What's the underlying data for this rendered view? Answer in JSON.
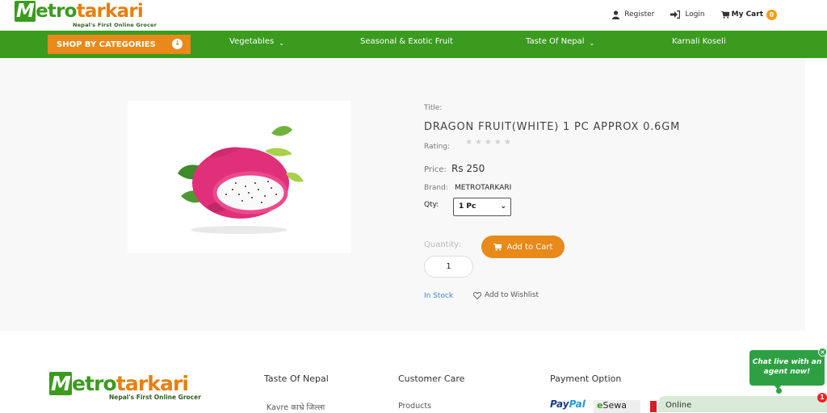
{
  "header": {
    "logo": {
      "m": "M",
      "rest_green": "etro",
      "rest_orange": "tarkari",
      "tagline": "Nepal's First Online Grocer"
    },
    "register_label": "Register",
    "login_label": "Login",
    "cart_label": "My Cart",
    "cart_count": "0"
  },
  "nav": {
    "shop_by_categories": "SHOP BY CATEGORIES",
    "items": [
      {
        "label": "Vegetables",
        "has_dropdown": true
      },
      {
        "label": "Seasonal & Exotic Fruit",
        "has_dropdown": false
      },
      {
        "label": "Taste Of Nepal",
        "has_dropdown": true
      },
      {
        "label": "Karnali Koseli",
        "has_dropdown": false
      }
    ],
    "chevron": "⌄"
  },
  "product": {
    "title_label": "Title:",
    "title": "DRAGON FRUIT(WHITE) 1 PC APPROX 0.6GM",
    "rating_label": "Rating:",
    "stars": "★★★★★",
    "rating_value": 0,
    "price_label": "Price:",
    "price": "Rs 250",
    "brand_label": "Brand:",
    "brand": "METROTARKARI",
    "qty_label": "Qty:",
    "qty_selected": "1 Pc",
    "quantity_label": "Quantity:",
    "quantity_value": "1",
    "add_to_cart": "Add to Cart",
    "stock_status": "In Stock",
    "wishlist": "Add to Wishlist"
  },
  "footer": {
    "logo": {
      "m": "M",
      "rest_green": "etro",
      "rest_orange": "tarkari",
      "tagline": "Nepal's First Online Grocer"
    },
    "columns": [
      {
        "heading": "Taste Of Nepal",
        "first_link": "Kavre काभ्रे जिल्ला"
      },
      {
        "heading": "Customer Care",
        "first_link": "Products"
      },
      {
        "heading": "Payment Option"
      }
    ],
    "payments": {
      "paypal_1": "Pay",
      "paypal_2": "Pal",
      "esewa_e": "e",
      "esewa_rest": "Sewa"
    }
  },
  "chat": {
    "bubble_text": "Chat live with an agent now!",
    "status": "Online",
    "badge": "1",
    "close": "×"
  },
  "colors": {
    "brand_green": "#3a9b1f",
    "brand_orange": "#e8891a",
    "stock_blue": "#3d88c9"
  }
}
